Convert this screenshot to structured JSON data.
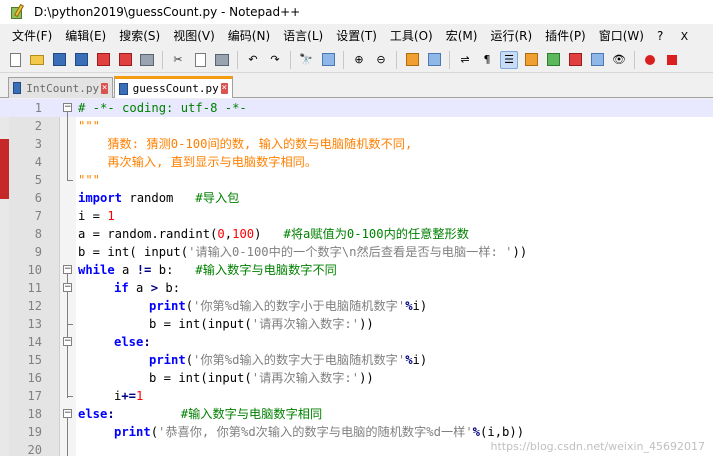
{
  "window": {
    "title": "D:\\python2019\\guessCount.py - Notepad++"
  },
  "menu": [
    "文件(F)",
    "编辑(E)",
    "搜索(S)",
    "视图(V)",
    "编码(N)",
    "语言(L)",
    "设置(T)",
    "工具(O)",
    "宏(M)",
    "运行(R)",
    "插件(P)",
    "窗口(W)",
    "?"
  ],
  "menu_close": "X",
  "toolbar": {
    "icons": [
      "new-file-icon",
      "open-folder-icon",
      "save-icon",
      "save-all-icon",
      "close-icon",
      "close-all-icon",
      "print-icon",
      "cut-icon",
      "copy-icon",
      "paste-icon",
      "undo-icon",
      "redo-icon",
      "find-icon",
      "replace-icon",
      "zoom-in-icon",
      "zoom-out-icon",
      "sync-vertical-icon",
      "sync-horizontal-icon",
      "word-wrap-icon",
      "show-all-chars-icon",
      "indent-guide-icon",
      "folder-as-workspace-icon",
      "function-list-icon",
      "document-map-icon",
      "monitor-icon",
      "record-macro-icon",
      "stop-record-icon"
    ]
  },
  "tabs": [
    {
      "label": "IntCount.py",
      "active": false
    },
    {
      "label": "guessCount.py",
      "active": true
    }
  ],
  "editor": {
    "lines": [
      {
        "n": "1"
      },
      {
        "n": "2"
      },
      {
        "n": "3"
      },
      {
        "n": "4"
      },
      {
        "n": "5"
      },
      {
        "n": "6"
      },
      {
        "n": "7"
      },
      {
        "n": "8"
      },
      {
        "n": "9"
      },
      {
        "n": "10"
      },
      {
        "n": "11"
      },
      {
        "n": "12"
      },
      {
        "n": "13"
      },
      {
        "n": "14"
      },
      {
        "n": "15"
      },
      {
        "n": "16"
      },
      {
        "n": "17"
      },
      {
        "n": "18"
      },
      {
        "n": "19"
      },
      {
        "n": "20"
      }
    ],
    "code": {
      "l1": "# -*- coding: utf-8 -*-",
      "l2": "\"\"\"",
      "l3": "    猜数: 猜测0-100间的数, 输入的数与电脑随机数不同,",
      "l4": "    再次输入, 直到显示与电脑数字相同。",
      "l5": "\"\"\"",
      "l6_kw": "import",
      "l6_mod": " random",
      "l6_cm": "#导入包",
      "l7_a": "i = ",
      "l7_num": "1",
      "l8_a": "a = random.randint(",
      "l8_n1": "0",
      "l8_b": ",",
      "l8_n2": "100",
      "l8_c": ")",
      "l8_cm": "#将a赋值为0-100内的任意整形数",
      "l9_a": "b = int( input(",
      "l9_str": "'请输入0-100中的一个数字\\n然后查看是否与电脑一样: '",
      "l9_b": "))",
      "l10_kw": "while",
      "l10_a": " a ",
      "l10_op": "!=",
      "l10_b": " b:",
      "l10_cm": "#输入数字与电脑数字不同",
      "l11_kw": "if",
      "l11_a": " a ",
      "l11_op": ">",
      "l11_b": " b:",
      "l12_kw": "print",
      "l12_a": "(",
      "l12_str": "'你第%d输入的数字小于电脑随机数字'",
      "l12_op": "%",
      "l12_b": "i)",
      "l13_a": "b = int(input(",
      "l13_str": "'请再次输入数字:'",
      "l13_b": "))",
      "l14_kw": "else",
      "l14_a": ":",
      "l15_kw": "print",
      "l15_a": "(",
      "l15_str": "'你第%d输入的数字大于电脑随机数字'",
      "l15_op": "%",
      "l15_b": "i)",
      "l16_a": "b = int(input(",
      "l16_str": "'请再次输入数字:'",
      "l16_b": "))",
      "l17_a": "i",
      "l17_op": "+=",
      "l17_num": "1",
      "l18_kw": "else",
      "l18_a": ":",
      "l18_cm": "#输入数字与电脑数字相同",
      "l19_kw": "print",
      "l19_a": "(",
      "l19_str": "'恭喜你, 你第%d次输入的数字与电脑的随机数字%d一样'",
      "l19_op": "%",
      "l19_b": "(i,b))"
    }
  },
  "watermark": "https://blog.csdn.net/weixin_45692017",
  "colors": {
    "keyword": "#0000ff",
    "comment": "#008000",
    "string": "#808080",
    "docstring": "#ff8000",
    "number": "#ff0000",
    "current_line": "#e8e8ff",
    "active_tab_accent": "#f39c12"
  }
}
